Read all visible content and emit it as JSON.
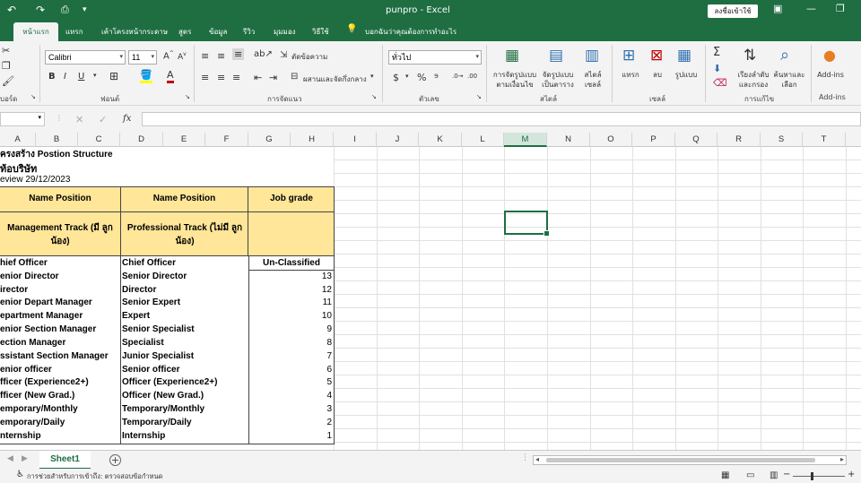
{
  "titlebar": {
    "undo_icon": "↶",
    "redo_icon": "↷",
    "doc_title": "punpro  -  Excel",
    "sign_in": "ลงชื่อเข้าใช้",
    "restore_icon": "❐",
    "accent": "#1e6e42"
  },
  "tabs": {
    "home": "หน้าแรก",
    "items": [
      "แทรก",
      "เค้าโครงหน้ากระดาษ",
      "สูตร",
      "ข้อมูล",
      "รีวิว",
      "มุมมอง",
      "วิธีใช้"
    ],
    "tell_me": "บอกฉันว่าคุณต้องการทำอะไร"
  },
  "ribbon": {
    "font_name": "Calibri",
    "font_size": "11",
    "wrap_text": "ตัดข้อความ",
    "merge_center": "ผสานและจัดกึ่งกลาง",
    "number_format": "ทั่วไป",
    "cond_format": [
      "การจัดรูปแบบ",
      "ตามเงื่อนไข"
    ],
    "format_table": [
      "จัดรูปแบบ",
      "เป็นตาราง"
    ],
    "cell_styles": [
      "สไตล์",
      "เซลล์"
    ],
    "insert": "แทรก",
    "delete": "ลบ",
    "format": "รูปแบบ",
    "sort_filter": [
      "เรียงลำดับ",
      "และกรอง"
    ],
    "find_select": [
      "ค้นหาและ",
      "เลือก"
    ],
    "addins": "Add-ins",
    "groups": {
      "clipboard": "บอร์ด",
      "font": "ฟอนต์",
      "alignment": "การจัดแนว",
      "number": "ตัวเลข",
      "styles": "สไตล์",
      "cells": "เซลล์",
      "editing": "การแก้ไข",
      "addins": "Add-ins"
    }
  },
  "formula_bar": {
    "fx": "fx"
  },
  "columns": [
    "A",
    "B",
    "C",
    "D",
    "E",
    "F",
    "G",
    "H",
    "I",
    "J",
    "K",
    "L",
    "M",
    "N",
    "O",
    "P",
    "Q",
    "R",
    "S",
    "T"
  ],
  "selected_column": "M",
  "sheet": {
    "title": "ครงสร้าง Postion Structure",
    "company": "ท้อบริษัท",
    "review": "eview 29/12/2023",
    "col_header_mgmt": "Name Position",
    "col_header_prof": "Name Position",
    "col_header_grade": "Job grade",
    "sub_mgmt": "Management Track (มี ลูกน้อง)",
    "sub_prof": "Professional Track (ไม่มี ลูกน้อง)",
    "rows": [
      {
        "mgmt": "hief Officer",
        "prof": "Chief Officer",
        "grade": "Un-Classified"
      },
      {
        "mgmt": "enior Director",
        "prof": "Senior Director",
        "grade": "13"
      },
      {
        "mgmt": "irector",
        "prof": "Director",
        "grade": "12"
      },
      {
        "mgmt": "enior Depart Manager",
        "prof": "Senior Expert",
        "grade": "11"
      },
      {
        "mgmt": "epartment Manager",
        "prof": "Expert",
        "grade": "10"
      },
      {
        "mgmt": "enior Section Manager",
        "prof": "Senior Specialist",
        "grade": "9"
      },
      {
        "mgmt": "ection Manager",
        "prof": "Specialist",
        "grade": "8"
      },
      {
        "mgmt": "ssistant Section Manager",
        "prof": "Junior Specialist",
        "grade": "7"
      },
      {
        "mgmt": "enior officer",
        "prof": "Senior officer",
        "grade": "6"
      },
      {
        "mgmt": "fficer (Experience2+)",
        "prof": "Officer (Experience2+)",
        "grade": "5"
      },
      {
        "mgmt": "fficer (New Grad.)",
        "prof": "Officer (New Grad.)",
        "grade": "4"
      },
      {
        "mgmt": "emporary/Monthly",
        "prof": "Temporary/Monthly",
        "grade": "3"
      },
      {
        "mgmt": "emporary/Daily",
        "prof": "Temporary/Daily",
        "grade": "2"
      },
      {
        "mgmt": "nternship",
        "prof": "Internship",
        "grade": "1"
      }
    ],
    "header_fill": "#ffe699"
  },
  "sheet_tabs": {
    "active": "Sheet1",
    "add": "+"
  },
  "status": {
    "text": "การช่วยสำหรับการเข้าถึง: ตรวจสอบข้อกำหนด"
  }
}
